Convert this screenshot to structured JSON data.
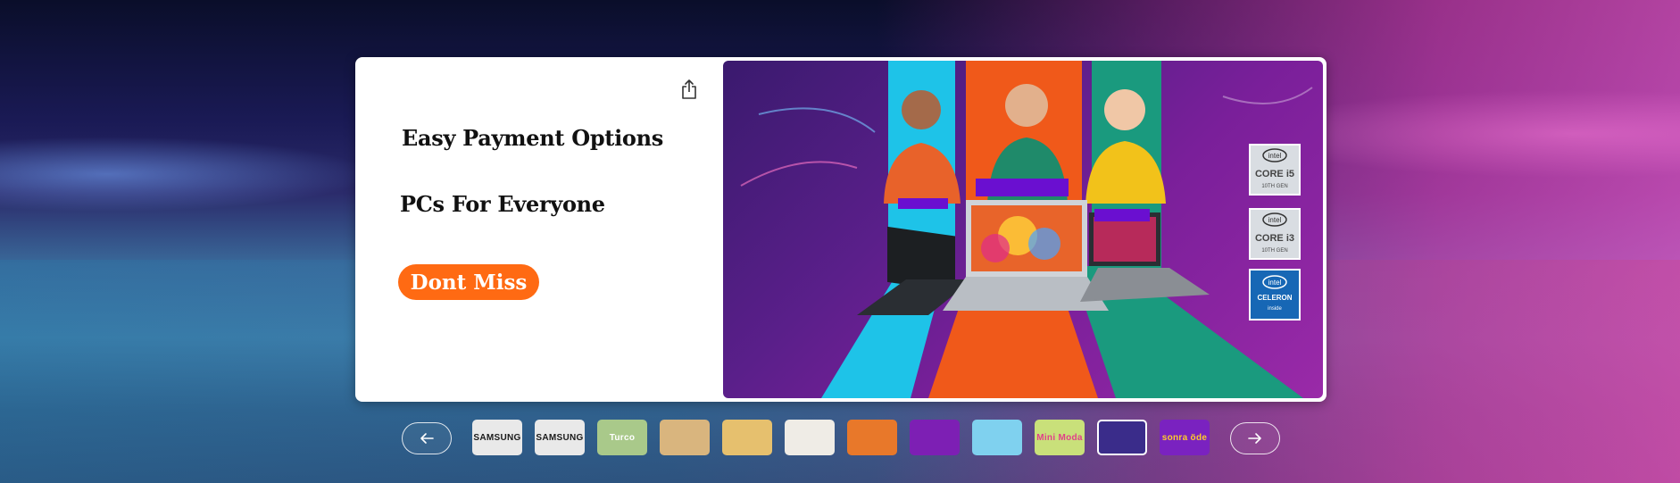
{
  "slide": {
    "headline": "Easy Payment Options",
    "subline": "PCs For Everyone",
    "cta_label": "Dont Miss"
  },
  "banner_badges": {
    "i5": {
      "brand": "intel",
      "line1": "CORE i5",
      "line2": "10TH GEN"
    },
    "i3": {
      "brand": "intel",
      "line1": "CORE i3",
      "line2": "10TH GEN"
    },
    "celeron": {
      "brand": "intel",
      "line1": "CELERON",
      "line2": "inside"
    }
  },
  "thumbnails": [
    {
      "label": "SAMSUNG",
      "bg": "#e9e9e9",
      "fg": "#1a1a1a"
    },
    {
      "label": "SAMSUNG",
      "bg": "#e9e9e9",
      "fg": "#1a1a1a"
    },
    {
      "label": "Turco",
      "bg": "#a9c98a",
      "fg": "#ffffff"
    },
    {
      "label": "",
      "bg": "#d9b57e",
      "fg": "#ffffff"
    },
    {
      "label": "",
      "bg": "#e6c06e",
      "fg": "#ffffff"
    },
    {
      "label": "",
      "bg": "#efece6",
      "fg": "#ffffff"
    },
    {
      "label": "",
      "bg": "#e8782a",
      "fg": "#ffffff"
    },
    {
      "label": "",
      "bg": "#7d1fb4",
      "fg": "#ffffff"
    },
    {
      "label": "",
      "bg": "#7fd1ef",
      "fg": "#ffffff"
    },
    {
      "label": "Mini Moda",
      "bg": "#c9e07a",
      "fg": "#e0408a"
    },
    {
      "label": "",
      "bg": "#3a2c8a",
      "fg": "#ffffff"
    },
    {
      "label": "sonra öde",
      "bg": "#7a22c0",
      "fg": "#ffcc2a"
    }
  ],
  "colors": {
    "cta": "#ff6a13",
    "banner_cyan": "#1ec3e8",
    "banner_orange": "#f0591a",
    "banner_teal": "#1a9a7e",
    "banner_purple": "#6a0fd0"
  }
}
